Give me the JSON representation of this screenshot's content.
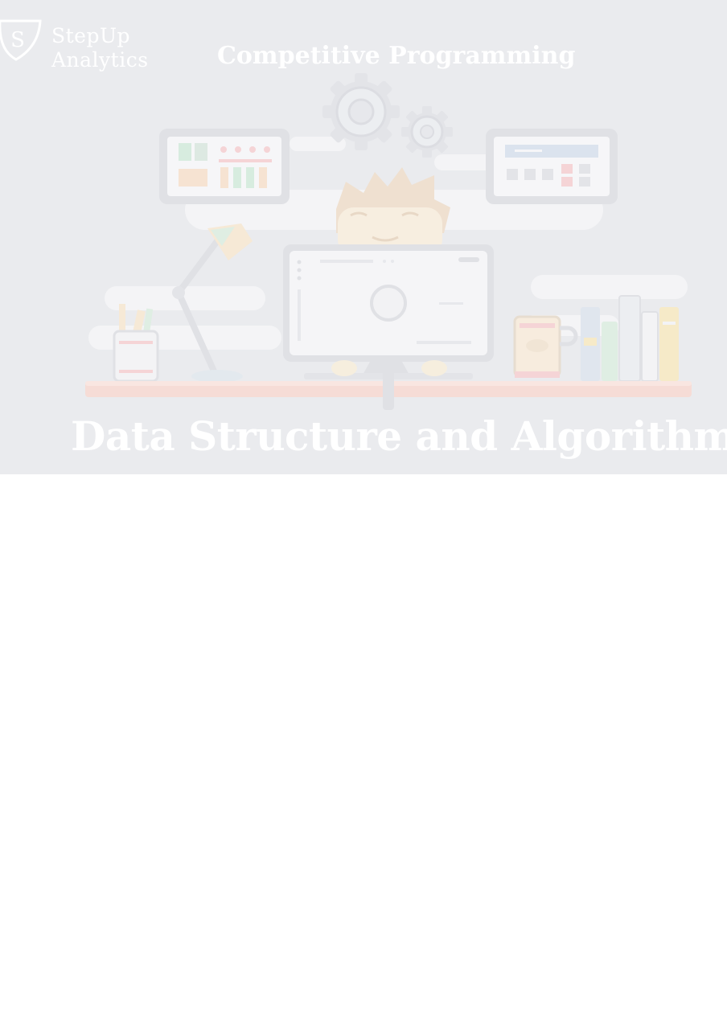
{
  "logo": {
    "mark_letter": "S",
    "line1": "StepUp",
    "line2": "Analytics"
  },
  "banner": {
    "subtitle": "Competitive Programming",
    "title": "Data Structure and Algorithms",
    "background_color": "#eaebee",
    "text_color": "#ffffff"
  },
  "illustration": {
    "icons": [
      "gear-icon",
      "monitor-icon",
      "desk-lamp-icon",
      "pencil-cup-icon",
      "mug-icon",
      "books-icon",
      "dashboard-frame-icon",
      "character-icon"
    ]
  }
}
